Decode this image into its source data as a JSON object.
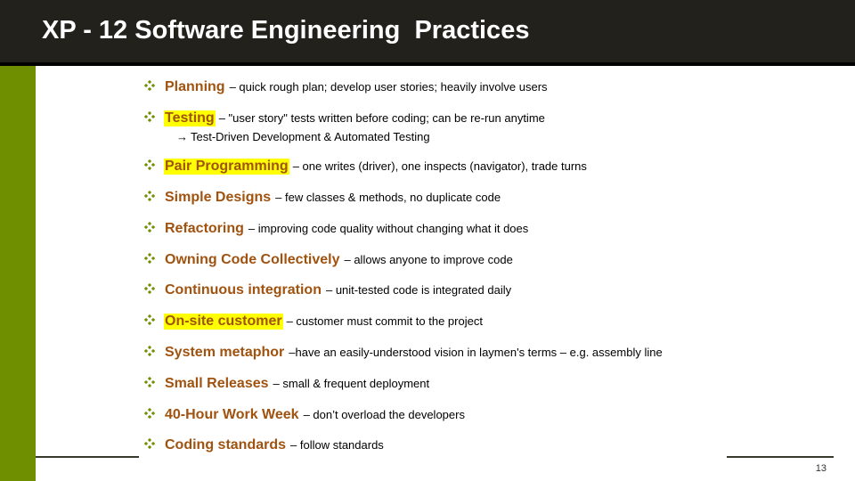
{
  "slide": {
    "title": "XP - 12 Software Engineering  Practices",
    "page_number": "13",
    "colors": {
      "title_bar": "#22211b",
      "accent_green": "#6f8f00",
      "term_brown": "#a0520f",
      "highlight": "#ffff00"
    },
    "bullet_icon": "four-diamond-bullet-icon",
    "items": [
      {
        "term": "Planning",
        "desc": "– quick rough plan; develop user stories; heavily involve users",
        "highlighted": false
      },
      {
        "term": "Testing",
        "desc": "– \"user story\" tests written before coding; can be re-run anytime",
        "highlighted": true,
        "sub": {
          "arrow": "→",
          "text": "Test-Driven Development & Automated Testing"
        }
      },
      {
        "term": "Pair Programming",
        "desc": "– one writes (driver), one inspects (navigator), trade turns",
        "highlighted": true
      },
      {
        "term": "Simple Designs",
        "desc": "– few classes & methods, no duplicate code",
        "highlighted": false
      },
      {
        "term": "Refactoring",
        "desc": "– improving code quality without changing what it does",
        "highlighted": false
      },
      {
        "term": "Owning Code Collectively",
        "desc": "– allows anyone to improve code",
        "highlighted": false
      },
      {
        "term": "Continuous integration",
        "desc": "– unit-tested code is integrated daily",
        "highlighted": false
      },
      {
        "term": "On-site customer",
        "desc": "– customer must commit to the project",
        "highlighted": true
      },
      {
        "term": "System metaphor",
        "desc": "–have an easily-understood vision in laymen's terms – e.g. assembly line",
        "highlighted": false
      },
      {
        "term": "Small Releases",
        "desc": "– small & frequent deployment",
        "highlighted": false
      },
      {
        "term": "40-Hour Work Week",
        "desc": "– don’t overload the developers",
        "highlighted": false
      },
      {
        "term": "Coding standards",
        "desc": "– follow standards",
        "highlighted": false
      }
    ]
  }
}
